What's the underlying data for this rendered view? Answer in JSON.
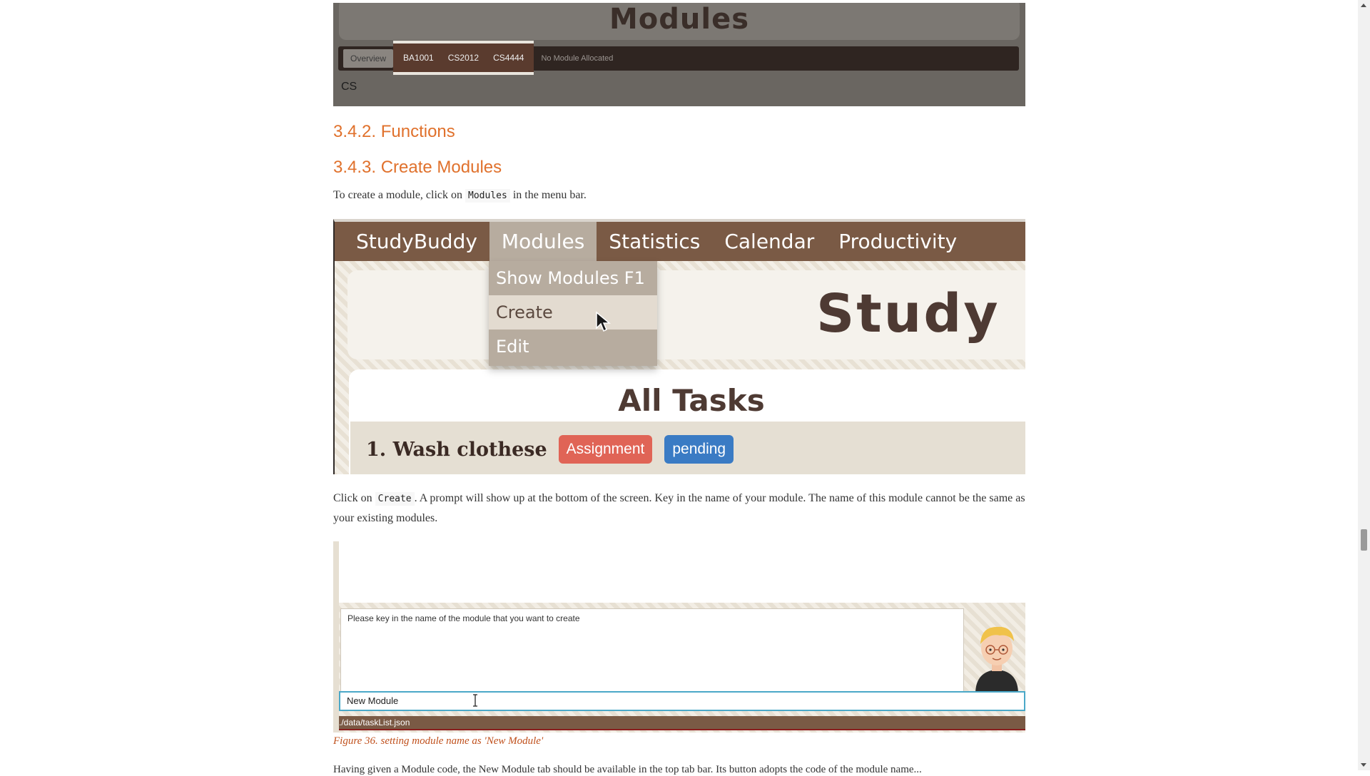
{
  "modules_shot": {
    "title": "Modules",
    "tabs": {
      "overview": "Overview",
      "module_tabs": [
        "BA1001",
        "CS2012",
        "CS4444"
      ],
      "none": "No Module Allocated"
    },
    "content": "CS"
  },
  "headings": {
    "functions": "3.4.2. Functions",
    "create_modules": "3.4.3. Create Modules"
  },
  "para1": {
    "before": "To create a module, click on ",
    "code": "Modules",
    "after": " in the menu bar."
  },
  "menu_shot": {
    "menubar": [
      "StudyBuddy",
      "Modules",
      "Statistics",
      "Calendar",
      "Productivity"
    ],
    "dropdown": {
      "show": "Show Modules  F1",
      "create": "Create",
      "edit": "Edit"
    },
    "hero_title": "Study B",
    "tasks_title": "All Tasks",
    "task": {
      "name": "1.  Wash clothese",
      "badge_type": "Assignment",
      "badge_status": "pending"
    }
  },
  "para2": {
    "before": "Click on ",
    "code": "Create",
    "after": ". A prompt will show up at the bottom of the screen. Key in the name of your module. The name of this module cannot be the same as your existing modules."
  },
  "prompt_shot": {
    "prompt": "Please key in the name of the module that you want to create",
    "input_value": "New Module",
    "status_path": "./data/taskList.json"
  },
  "caption": "Figure 36. setting module name as 'New Module'",
  "cut_text": "Having given a Module code, the New Module tab should be available in the top tab bar. Its button adopts the code of the module name...",
  "colors": {
    "heading": "#e0712c",
    "caption": "#c0501c",
    "menubar": "#7a5a45",
    "assignment_badge": "#e06456",
    "pending_badge": "#3a7bc4"
  }
}
